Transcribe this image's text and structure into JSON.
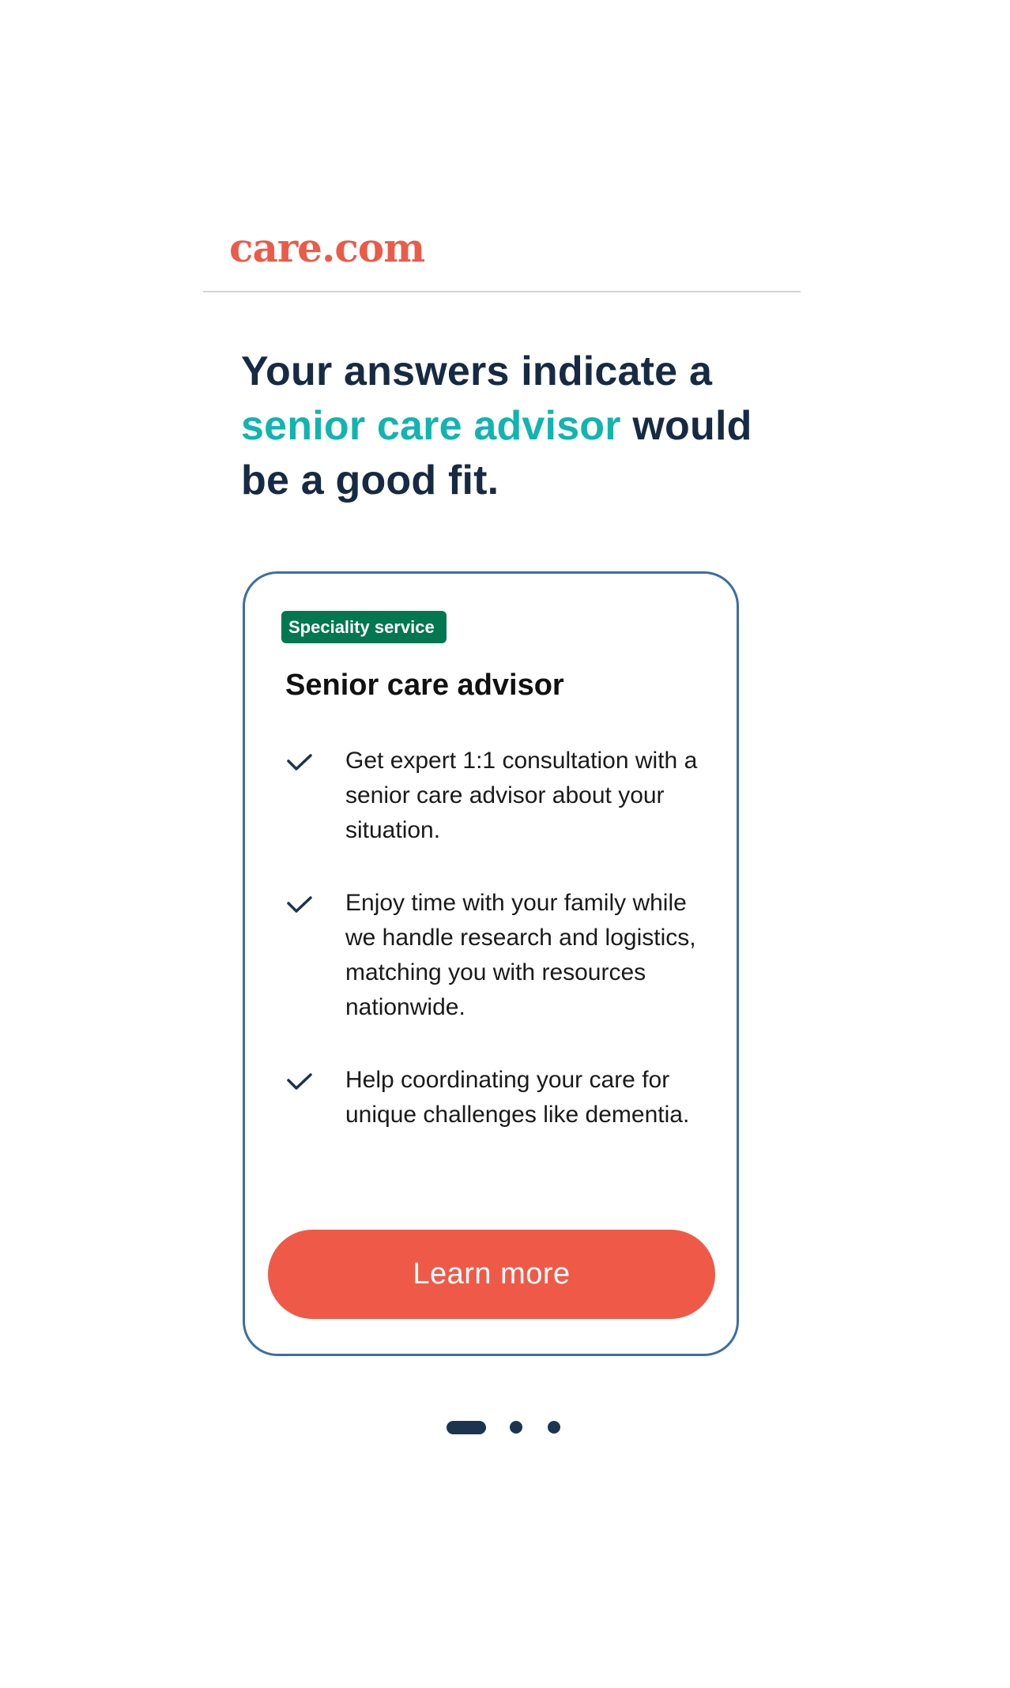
{
  "brand": {
    "logo_text": "care.com",
    "accent_color": "#ea5b48"
  },
  "headline": {
    "part1": "Your answers indicate a",
    "accent": "senior care advisor",
    "part2": "would be a good fit."
  },
  "card": {
    "badge": "Speciality service",
    "title": "Senior care advisor",
    "features": [
      {
        "icon": "check-icon",
        "text": "Get expert 1:1 consultation with a senior care advisor about your situation."
      },
      {
        "icon": "check-icon",
        "text": "Enjoy time with your family while we handle research and logistics, matching you with resources nationwide."
      },
      {
        "icon": "check-icon",
        "text": "Help coordinating your care for unique challenges like dementia."
      }
    ],
    "button_label": "Learn more"
  },
  "carousel": {
    "total": 3,
    "active_index": 0
  },
  "colors": {
    "headline": "#172a43",
    "accent_teal": "#12b4b0",
    "card_border": "#3c6da6",
    "badge_bg": "#03774f",
    "button_bg": "#ef5a48",
    "dots": "#1d3450"
  }
}
